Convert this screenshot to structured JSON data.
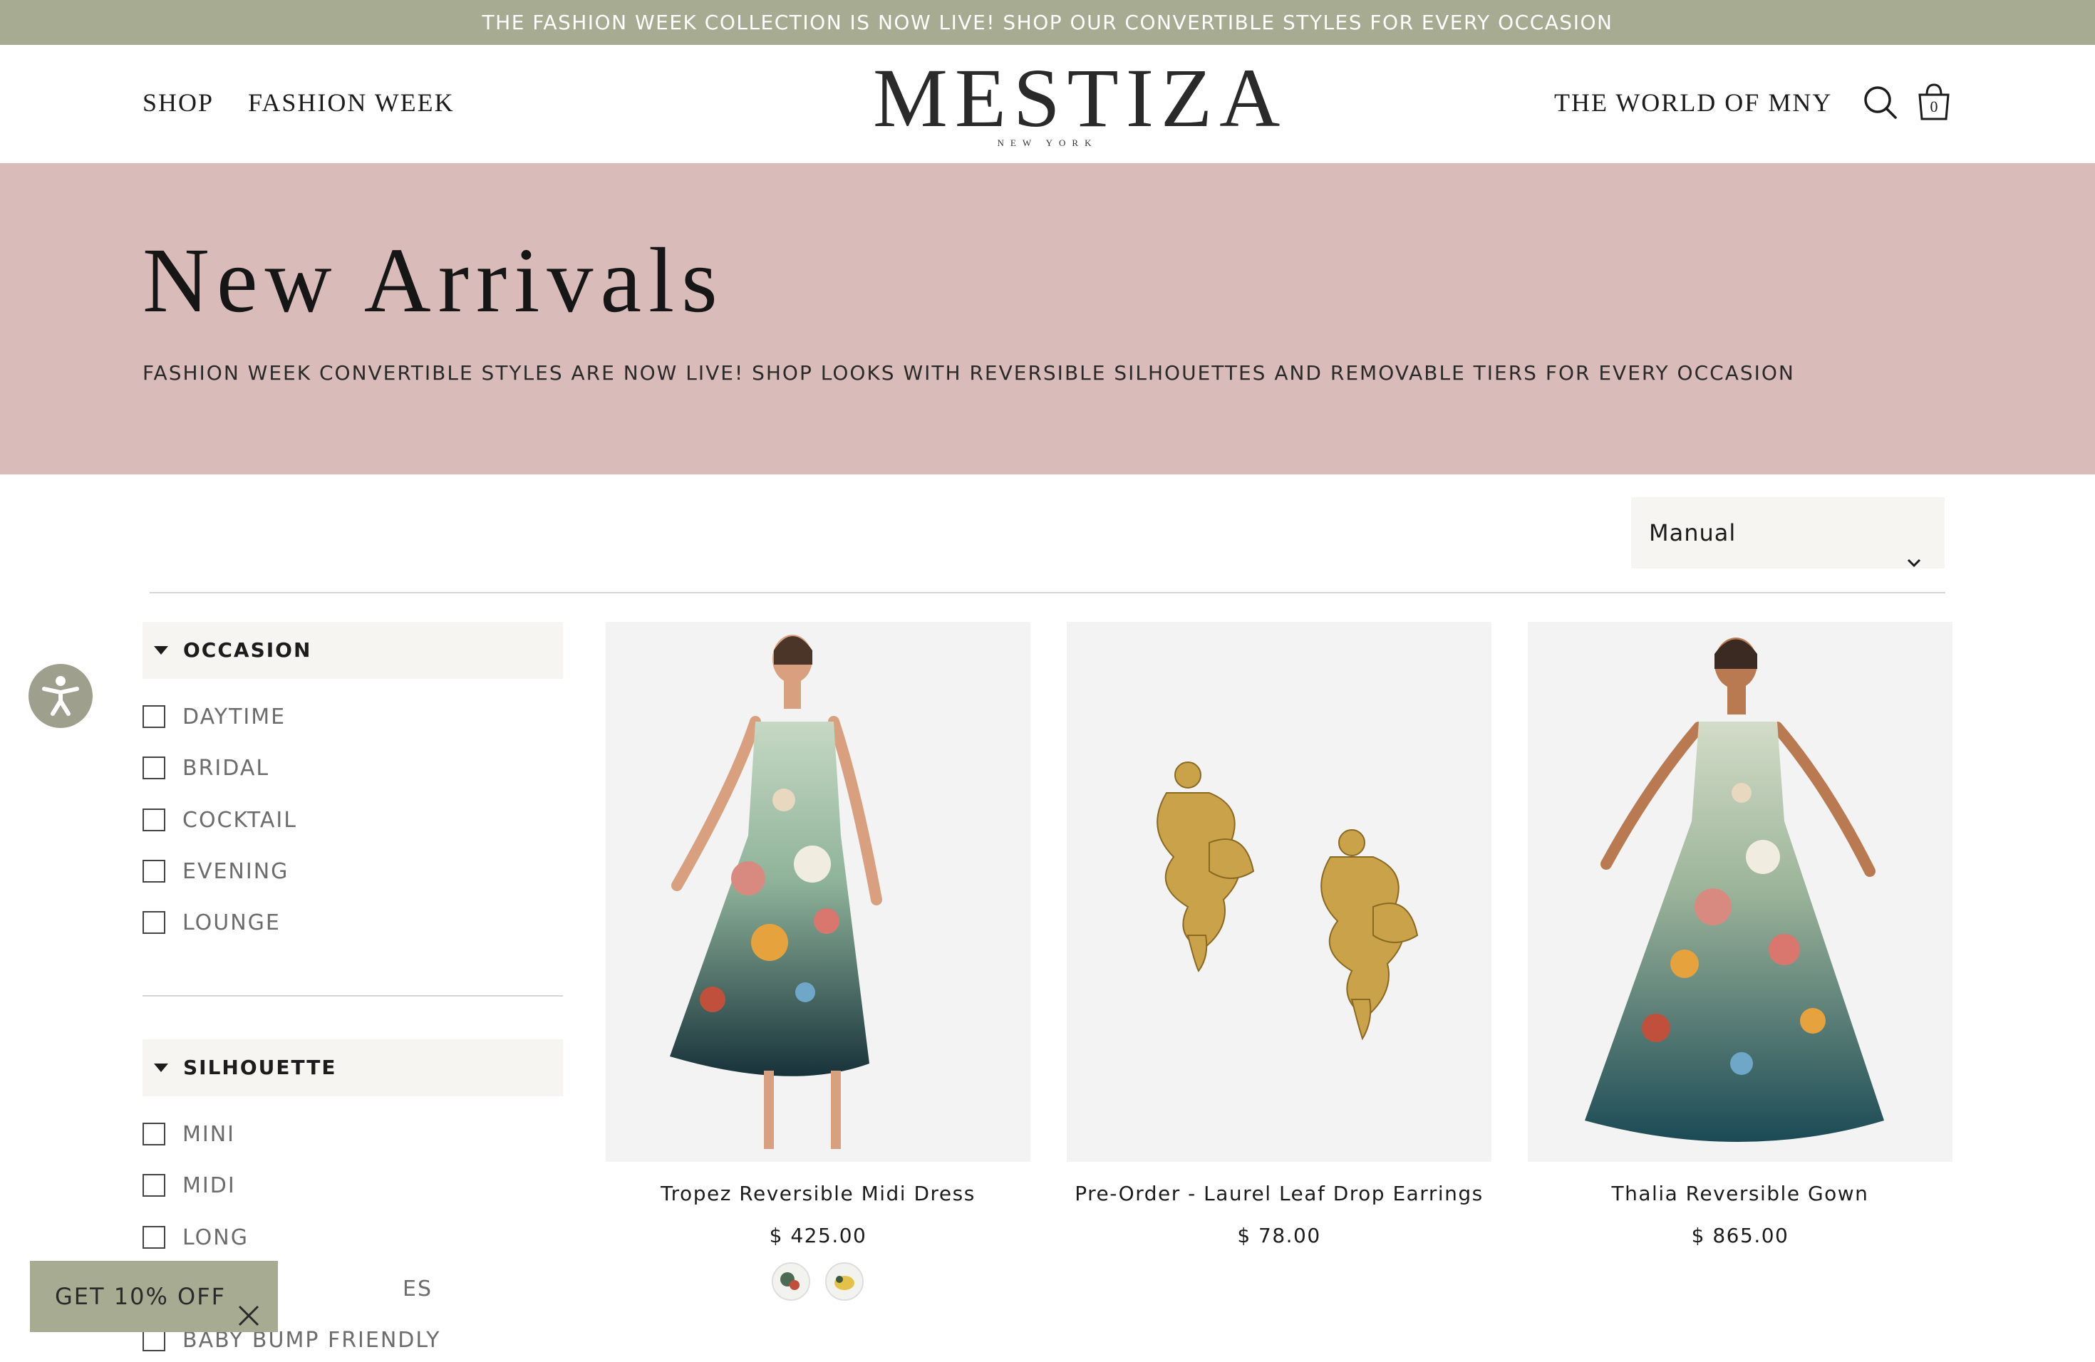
{
  "announcement": "THE FASHION WEEK COLLECTION IS NOW LIVE! SHOP OUR CONVERTIBLE STYLES FOR EVERY OCCASION",
  "header": {
    "nav": [
      "SHOP",
      "FASHION WEEK"
    ],
    "logo": "MESTIZA",
    "logo_sub": "NEW YORK",
    "world_link": "THE WORLD OF MNY",
    "cart_count": "0",
    "icons": [
      "search-icon",
      "shopping-bag-icon"
    ]
  },
  "hero": {
    "title": "New Arrivals",
    "subtitle": "FASHION WEEK CONVERTIBLE STYLES ARE NOW LIVE! SHOP LOOKS WITH REVERSIBLE SILHOUETTES AND REMOVABLE TIERS FOR EVERY OCCASION"
  },
  "sort": {
    "value": "Manual"
  },
  "filters": {
    "occasion": {
      "title": "OCCASION",
      "options": [
        "DAYTIME",
        "BRIDAL",
        "COCKTAIL",
        "EVENING",
        "LOUNGE"
      ]
    },
    "silhouette": {
      "title": "SILHOUETTE",
      "options": [
        "MINI",
        "MIDI",
        "LONG",
        "ES",
        "BABY BUMP FRIENDLY"
      ]
    }
  },
  "products": [
    {
      "title": "Tropez Reversible Midi Dress",
      "price": "$ 425.00"
    },
    {
      "title": "Pre-Order - Laurel Leaf Drop Earrings",
      "price": "$ 78.00"
    },
    {
      "title": "Thalia Reversible Gown",
      "price": "$ 865.00"
    }
  ],
  "swatch_colors": [
    "#4c6b55",
    "#e4c24a"
  ],
  "discount_tab": "GET 10% OFF",
  "colors": {
    "announcement_bg": "#a7ab91",
    "hero_bg": "#d9bcb9",
    "filter_bg": "#f6f5f2",
    "a11y_bg": "#9ea08d"
  }
}
